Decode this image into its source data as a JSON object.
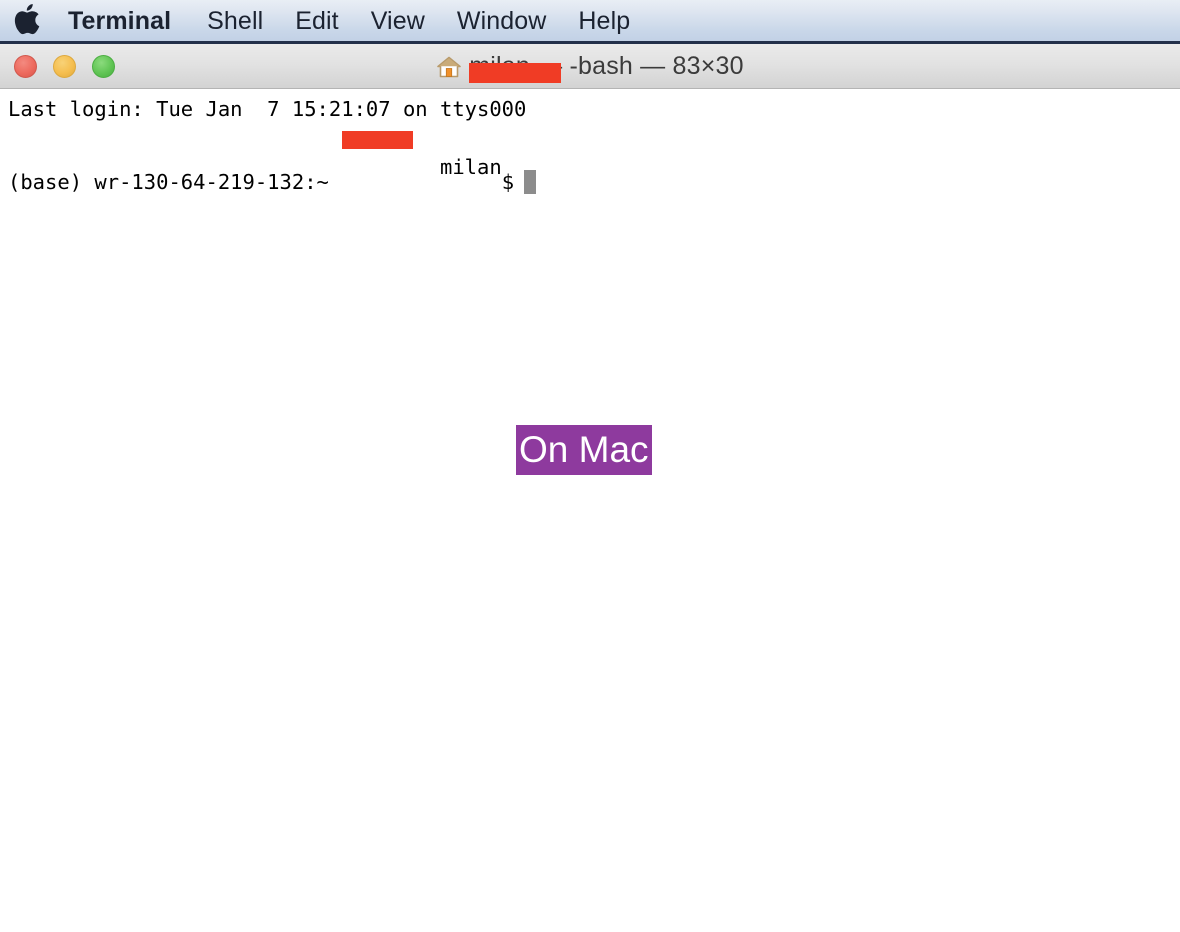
{
  "menubar": {
    "apple_icon": "apple-logo-icon",
    "items": [
      {
        "label": "Terminal",
        "bold": true
      },
      {
        "label": "Shell"
      },
      {
        "label": "Edit"
      },
      {
        "label": "View"
      },
      {
        "label": "Window"
      },
      {
        "label": "Help"
      }
    ]
  },
  "window": {
    "traffic_lights": {
      "close": "close-button",
      "minimize": "minimize-button",
      "zoom": "zoom-button"
    },
    "title": {
      "home_icon": "house-icon",
      "user": "milan",
      "rest": " — -bash — 83×30",
      "redacted": true
    }
  },
  "terminal": {
    "lines": [
      "Last login: Tue Jan  7 15:21:07 on ttys000"
    ],
    "prompt": {
      "prefix": "(base) wr-130-64-219-132:~ ",
      "user": "milan",
      "suffix": "$",
      "redacted": true
    }
  },
  "annotation": {
    "text": "On Mac",
    "background_color": "#8e3a9e",
    "text_color": "#ffffff"
  },
  "colors": {
    "menubar_bg": "#c9d7e9",
    "menubar_border": "#23304a",
    "titlebar_bg": "#e2e2e2",
    "terminal_bg": "#ffffff",
    "terminal_text": "#000000",
    "redaction": "#f03c25",
    "cursor": "#8c8c8c",
    "light_close": "#ed6a5e",
    "light_min": "#f5be4f",
    "light_zoom": "#61c555"
  }
}
